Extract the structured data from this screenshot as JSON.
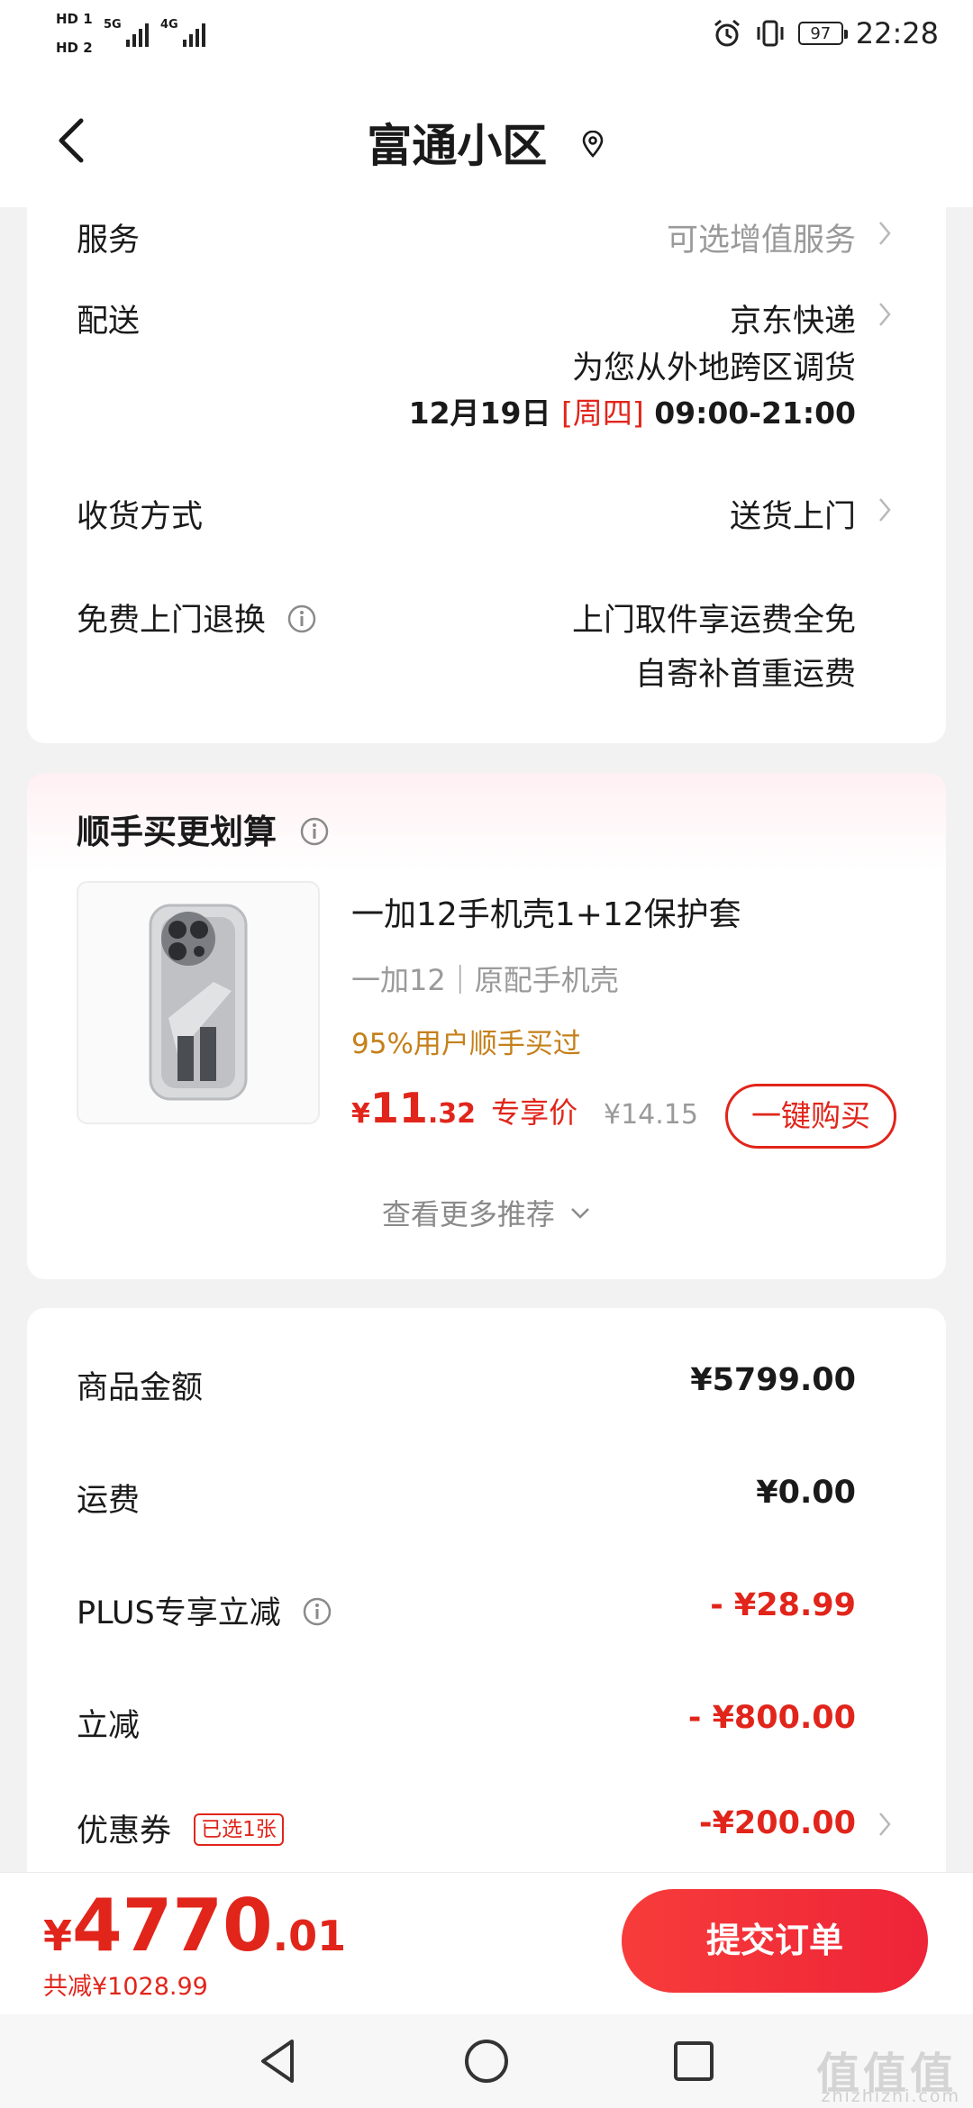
{
  "status_bar": {
    "hd1": "HD 1",
    "hd2": "HD 2",
    "net1": "5G",
    "net2": "4G",
    "battery": "97",
    "time": "22:28"
  },
  "header": {
    "title": "富通小区"
  },
  "service_card": {
    "service_label": "服务",
    "service_value": "可选增值服务",
    "delivery_label": "配送",
    "delivery_value": "京东快递",
    "delivery_note": "为您从外地跨区调货",
    "delivery_date": "12月19日",
    "delivery_weekday": "[周四]",
    "delivery_time": "09:00-21:00",
    "receive_label": "收货方式",
    "receive_value": "送货上门",
    "return_label": "免费上门退换",
    "return_line1": "上门取件享运费全免",
    "return_line2": "自寄补首重运费"
  },
  "recommend_card": {
    "heading": "顺手买更划算",
    "product_title": "一加12手机壳1+12保护套",
    "product_spec": "一加12｜原配手机壳",
    "product_badge": "95%用户顺手买过",
    "price_symbol": "¥",
    "price_int": "11",
    "price_dec": ".32",
    "price_tag": "专享价",
    "orig_price": "¥14.15",
    "buy_button": "一键购买",
    "more_link": "查看更多推荐"
  },
  "summary_card": {
    "goods_label": "商品金额",
    "goods_value": "¥5799.00",
    "shipping_label": "运费",
    "shipping_value": "¥0.00",
    "plus_label": "PLUS专享立减",
    "plus_value": "- ¥28.99",
    "discount_label": "立减",
    "discount_value": "- ¥800.00",
    "coupon_label": "优惠券",
    "coupon_tag": "已选1张",
    "coupon_value": "-¥200.00"
  },
  "bottom_bar": {
    "total_symbol": "¥",
    "total_int": "4770",
    "total_dec": ".01",
    "saved": "共减¥1028.99",
    "submit_label": "提交订单"
  },
  "watermark": {
    "logo": "值值值",
    "site": "zhizhizhi.com"
  },
  "colors": {
    "accent_red": "#e1251b",
    "badge_gold": "#c5801a",
    "gray_text": "#9a9a9a"
  }
}
